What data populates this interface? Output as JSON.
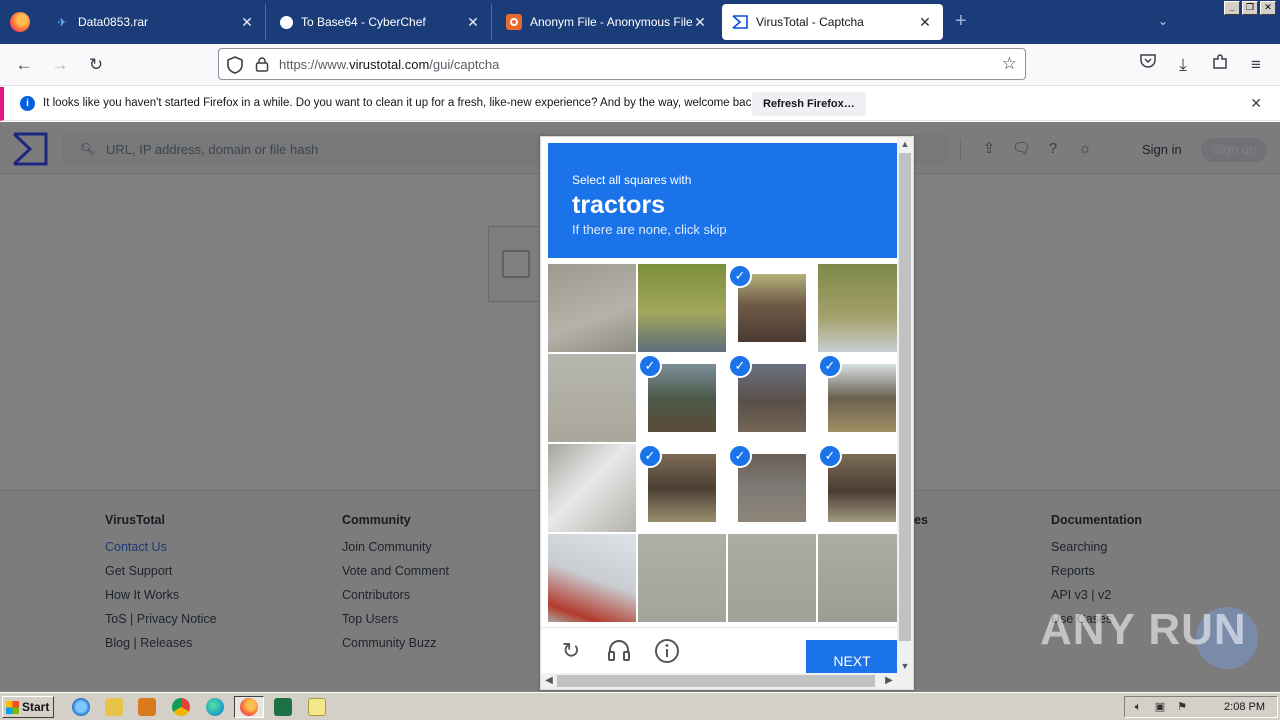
{
  "browser": {
    "tabs": [
      {
        "title": "Data0853.rar",
        "icon": "paper-plane-icon",
        "active": false
      },
      {
        "title": "To Base64 - CyberChef",
        "icon": "chef-hat-icon",
        "active": false
      },
      {
        "title": "Anonym File - Anonymous File Uplo",
        "icon": "anonym-file-icon",
        "active": false
      },
      {
        "title": "VirusTotal - Captcha",
        "icon": "virustotal-icon",
        "active": true
      }
    ],
    "url_prefix": "https://www.",
    "url_domain": "virustotal.com",
    "url_path": "/gui/captcha"
  },
  "notification": {
    "message": "It looks like you haven't started Firefox in a while. Do you want to clean it up for a fresh, like-new experience? And by the way, welcome back!",
    "button": "Refresh Firefox…"
  },
  "vt": {
    "search_placeholder": "URL, IP address, domain or file hash",
    "sign_in": "Sign in",
    "sign_up": "Sign up"
  },
  "footer": {
    "columns": [
      {
        "heading": "VirusTotal",
        "links": [
          "Contact Us",
          "Get Support",
          "How It Works",
          "ToS | Privacy Notice",
          "Blog | Releases"
        ]
      },
      {
        "heading": "Community",
        "links": [
          "Join Community",
          "Vote and Comment",
          "Contributors",
          "Top Users",
          "Community Buzz"
        ]
      },
      {
        "heading": "es",
        "links": []
      },
      {
        "heading": "Documentation",
        "links": [
          "Searching",
          "Reports",
          "API v3 | v2",
          "Use Cases"
        ]
      }
    ]
  },
  "captcha": {
    "prompt": "Select all squares with",
    "target": "tractors",
    "hint": "If there are none, click skip",
    "next_label": "NEXT",
    "selected": [
      false,
      false,
      true,
      false,
      false,
      true,
      true,
      true,
      false,
      true,
      true,
      true,
      false,
      false,
      false,
      false
    ]
  },
  "watermark": "ANY RUN",
  "taskbar": {
    "start_label": "Start",
    "clock": "2:08 PM"
  },
  "colors": {
    "tab_strip": "#1a3d7a",
    "captcha_blue": "#1a73e8",
    "notice_accent": "#e31587"
  }
}
